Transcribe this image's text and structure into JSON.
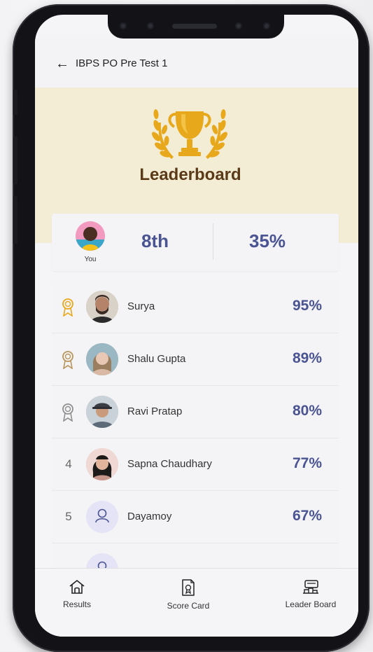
{
  "header": {
    "title": "IBPS PO Pre Test 1"
  },
  "banner": {
    "title": "Leaderboard"
  },
  "you": {
    "label": "You",
    "rank": "8th",
    "score": "35%"
  },
  "leaderboard": [
    {
      "name": "Surya",
      "score": "95%",
      "medal": "gold-medal-icon"
    },
    {
      "name": "Shalu Gupta",
      "score": "89%",
      "medal": "bronze-medal-icon"
    },
    {
      "name": "Ravi Pratap",
      "score": "80%",
      "medal": "silver-medal-icon"
    },
    {
      "rank": "4",
      "name": "Sapna Chaudhary",
      "score": "77%"
    },
    {
      "rank": "5",
      "name": "Dayamoy",
      "score": "67%"
    }
  ],
  "nav": [
    {
      "label": "Results",
      "icon": "home-icon"
    },
    {
      "label": "Score Card",
      "icon": "scorecard-icon"
    },
    {
      "label": "Leader Board",
      "icon": "leaderboard-icon"
    }
  ],
  "colors": {
    "accent": "#4a5492",
    "banner": "#f3edd6",
    "title": "#5b3a18",
    "gold": "#e8a81c"
  }
}
